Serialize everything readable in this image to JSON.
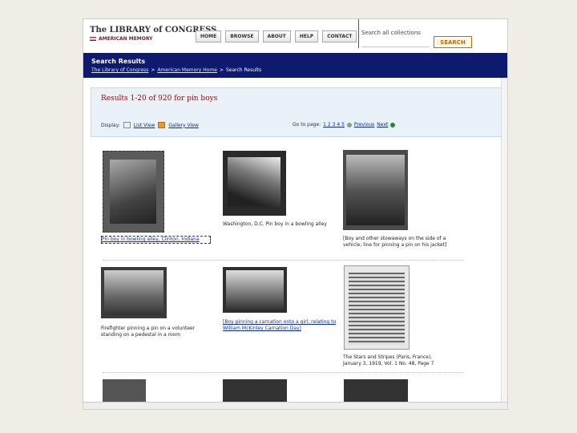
{
  "header": {
    "logo_line1": "The LIBRARY of CONGRESS",
    "logo_line2": "AMERICAN MEMORY",
    "nav": [
      "HOME",
      "BROWSE",
      "ABOUT",
      "HELP",
      "CONTACT"
    ],
    "search_text": "Search all collections",
    "search_placeholder": "",
    "search_button": "SEARCH"
  },
  "banner": {
    "title": "Search Results",
    "crumbs": [
      "The Library of Congress",
      ">",
      "American Memory Home",
      ">",
      "Search Results"
    ]
  },
  "results": {
    "title": "Results 1-20 of 920 for pin boys",
    "display_label": "Display:",
    "list_view": "List View",
    "gallery_view": "Gallery View",
    "goto_label": "Go to page:",
    "pages": "1 2 3 4 5",
    "previous": "Previous",
    "next": "Next"
  },
  "items": [
    {
      "caption": "Pin boy in bowling alley, Clinton, Indiana"
    },
    {
      "caption": "Washington, D.C. Pin boy in a bowling alley"
    },
    {
      "caption": "[Boy and other stowaways on the side of a vehicle; line for pinning a pin on his jacket]"
    },
    {
      "caption": "Firefighter pinning a pin on a volunteer standing on a pedestal in a room"
    },
    {
      "caption": "[Boy pinning a carnation onto a girl; relating to William McKinley Carnation Day]"
    },
    {
      "caption": "The Stars and Stripes (Paris, France), January 3, 1919, Vol. 1 No. 48, Page 7"
    }
  ]
}
